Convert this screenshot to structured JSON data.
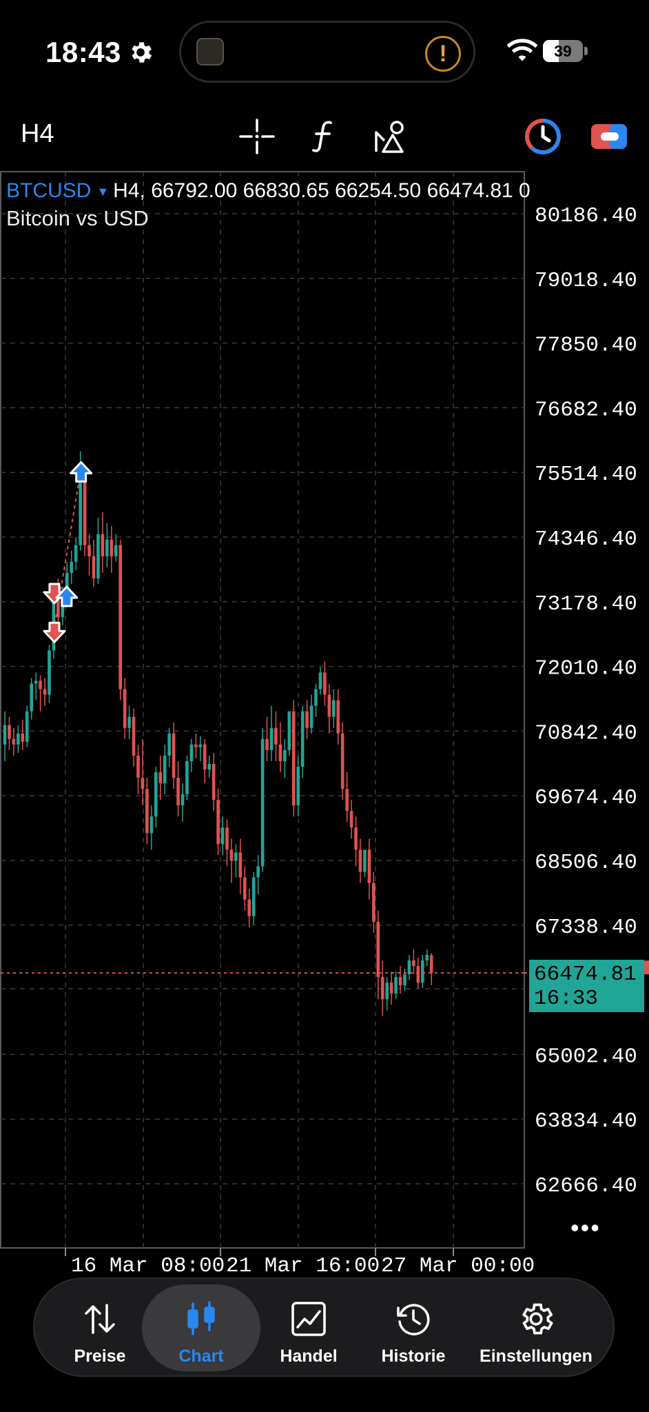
{
  "status_bar": {
    "time": "18:43",
    "battery": "39",
    "gear_icon": "gear-icon",
    "wifi_icon": "wifi-icon"
  },
  "toolbar": {
    "timeframe": "H4",
    "tools": [
      "crosshair-icon",
      "indicator-f-icon",
      "objects-icon",
      "clock-ring-icon",
      "toggle-icon"
    ]
  },
  "chart": {
    "symbol": "BTCUSD",
    "ohlc_line": "H4, 66792.00 66830.65 66254.50 66474.81 0",
    "description": "Bitcoin vs USD",
    "price_labels": [
      "80186.40",
      "79018.40",
      "77850.40",
      "76682.40",
      "75514.40",
      "74346.40",
      "73178.40",
      "72010.40",
      "70842.40",
      "69674.40",
      "68506.40",
      "67338.40",
      "65002.40",
      "63834.40",
      "62666.40"
    ],
    "time_labels": [
      "16 Mar 08:00",
      "21 Mar 16:00",
      "27 Mar 00:00"
    ],
    "current_price": "66474.81",
    "countdown": "16:33",
    "colors": {
      "bull": "#21a596",
      "bear": "#e0534f",
      "buy_arrow": "#2b86f0",
      "sell_arrow": "#e0534f",
      "accent": "#2b86f0"
    }
  },
  "chart_data": {
    "type": "candlestick",
    "title": "Bitcoin vs USD",
    "symbol": "BTCUSD",
    "timeframe": "H4",
    "ylim": [
      61750,
      80700
    ],
    "y_ticks": [
      80186.4,
      79018.4,
      77850.4,
      76682.4,
      75514.4,
      74346.4,
      73178.4,
      72010.4,
      70842.4,
      69674.4,
      68506.4,
      67338.4,
      65002.4,
      63834.4,
      62666.4
    ],
    "x_ticks": [
      "16 Mar 08:00",
      "21 Mar 16:00",
      "27 Mar 00:00"
    ],
    "last_price": 66474.81,
    "candles": [
      {
        "o": 70600,
        "h": 71200,
        "c": 70950,
        "l": 70300
      },
      {
        "o": 70950,
        "h": 71100,
        "c": 70700,
        "l": 70500
      },
      {
        "o": 70700,
        "h": 70900,
        "c": 70600,
        "l": 70400
      },
      {
        "o": 70600,
        "h": 70950,
        "c": 70800,
        "l": 70450
      },
      {
        "o": 70800,
        "h": 71050,
        "c": 70650,
        "l": 70500
      },
      {
        "o": 70650,
        "h": 71300,
        "c": 71200,
        "l": 70550
      },
      {
        "o": 71200,
        "h": 71800,
        "c": 71700,
        "l": 71050
      },
      {
        "o": 71700,
        "h": 71900,
        "c": 71750,
        "l": 71400
      },
      {
        "o": 71750,
        "h": 71850,
        "c": 71600,
        "l": 71200
      },
      {
        "o": 71600,
        "h": 71800,
        "c": 71500,
        "l": 71300
      },
      {
        "o": 71500,
        "h": 72400,
        "c": 72300,
        "l": 71350
      },
      {
        "o": 72300,
        "h": 73400,
        "c": 73300,
        "l": 72150
      },
      {
        "o": 73300,
        "h": 73600,
        "c": 72900,
        "l": 72700
      },
      {
        "o": 72900,
        "h": 73450,
        "c": 73350,
        "l": 72750
      },
      {
        "o": 73350,
        "h": 73900,
        "c": 73700,
        "l": 73150
      },
      {
        "o": 73700,
        "h": 74100,
        "c": 73900,
        "l": 73500
      },
      {
        "o": 73900,
        "h": 74350,
        "c": 74200,
        "l": 73750
      },
      {
        "o": 74200,
        "h": 75900,
        "c": 75400,
        "l": 74100
      },
      {
        "o": 75400,
        "h": 75600,
        "c": 74200,
        "l": 74000
      },
      {
        "o": 74200,
        "h": 74400,
        "c": 74000,
        "l": 73650
      },
      {
        "o": 74000,
        "h": 74300,
        "c": 73600,
        "l": 73450
      },
      {
        "o": 73600,
        "h": 74700,
        "c": 74400,
        "l": 73500
      },
      {
        "o": 74400,
        "h": 74800,
        "c": 74000,
        "l": 73700
      },
      {
        "o": 74000,
        "h": 74600,
        "c": 74300,
        "l": 73800
      },
      {
        "o": 74300,
        "h": 74550,
        "c": 74000,
        "l": 73700
      },
      {
        "o": 74000,
        "h": 74400,
        "c": 74200,
        "l": 73900
      },
      {
        "o": 74200,
        "h": 74300,
        "c": 71600,
        "l": 71400
      },
      {
        "o": 71600,
        "h": 71800,
        "c": 70900,
        "l": 70700
      },
      {
        "o": 70900,
        "h": 71300,
        "c": 71100,
        "l": 70700
      },
      {
        "o": 71100,
        "h": 71250,
        "c": 70400,
        "l": 70200
      },
      {
        "o": 70400,
        "h": 70600,
        "c": 70000,
        "l": 69700
      },
      {
        "o": 70000,
        "h": 70700,
        "c": 69800,
        "l": 69500
      },
      {
        "o": 69800,
        "h": 70000,
        "c": 69000,
        "l": 68800
      },
      {
        "o": 69000,
        "h": 69500,
        "c": 69300,
        "l": 68700
      },
      {
        "o": 69300,
        "h": 70200,
        "c": 70100,
        "l": 69100
      },
      {
        "o": 70100,
        "h": 70400,
        "c": 69900,
        "l": 69600
      },
      {
        "o": 69900,
        "h": 70600,
        "c": 70400,
        "l": 69700
      },
      {
        "o": 70400,
        "h": 70900,
        "c": 70800,
        "l": 70200
      },
      {
        "o": 70800,
        "h": 71000,
        "c": 70000,
        "l": 69800
      },
      {
        "o": 70000,
        "h": 70300,
        "c": 69500,
        "l": 69300
      },
      {
        "o": 69500,
        "h": 69900,
        "c": 69700,
        "l": 69200
      },
      {
        "o": 69700,
        "h": 70400,
        "c": 70300,
        "l": 69600
      },
      {
        "o": 70300,
        "h": 70700,
        "c": 70600,
        "l": 70100
      },
      {
        "o": 70600,
        "h": 70800,
        "c": 70550,
        "l": 70350
      },
      {
        "o": 70550,
        "h": 70750,
        "c": 70600,
        "l": 70300
      },
      {
        "o": 70600,
        "h": 70700,
        "c": 70150,
        "l": 69900
      },
      {
        "o": 70150,
        "h": 70400,
        "c": 70250,
        "l": 70000
      },
      {
        "o": 70250,
        "h": 70450,
        "c": 69600,
        "l": 69400
      },
      {
        "o": 69600,
        "h": 69800,
        "c": 68800,
        "l": 68600
      },
      {
        "o": 68800,
        "h": 69300,
        "c": 69100,
        "l": 68600
      },
      {
        "o": 69100,
        "h": 69250,
        "c": 68700,
        "l": 68400
      },
      {
        "o": 68700,
        "h": 68900,
        "c": 68500,
        "l": 68100
      },
      {
        "o": 68500,
        "h": 68800,
        "c": 68650,
        "l": 68200
      },
      {
        "o": 68650,
        "h": 68900,
        "c": 68200,
        "l": 67900
      },
      {
        "o": 68200,
        "h": 68400,
        "c": 67800,
        "l": 67600
      },
      {
        "o": 67800,
        "h": 68000,
        "c": 67500,
        "l": 67300
      },
      {
        "o": 67500,
        "h": 68300,
        "c": 68200,
        "l": 67350
      },
      {
        "o": 68200,
        "h": 68600,
        "c": 68400,
        "l": 67900
      },
      {
        "o": 68400,
        "h": 70900,
        "c": 70700,
        "l": 68300
      },
      {
        "o": 70700,
        "h": 71100,
        "c": 70500,
        "l": 70300
      },
      {
        "o": 70500,
        "h": 71300,
        "c": 70900,
        "l": 70300
      },
      {
        "o": 70900,
        "h": 71200,
        "c": 70600,
        "l": 70300
      },
      {
        "o": 70600,
        "h": 71000,
        "c": 70300,
        "l": 70100
      },
      {
        "o": 70300,
        "h": 70700,
        "c": 70500,
        "l": 70000
      },
      {
        "o": 70500,
        "h": 70700,
        "c": 71200,
        "l": 70400
      },
      {
        "o": 71200,
        "h": 71400,
        "c": 69500,
        "l": 69300
      },
      {
        "o": 69500,
        "h": 70400,
        "c": 70200,
        "l": 69300
      },
      {
        "o": 70200,
        "h": 71300,
        "c": 71200,
        "l": 70000
      },
      {
        "o": 71200,
        "h": 71400,
        "c": 70900,
        "l": 70700
      },
      {
        "o": 70900,
        "h": 71500,
        "c": 71300,
        "l": 70800
      },
      {
        "o": 71300,
        "h": 71700,
        "c": 71600,
        "l": 71100
      },
      {
        "o": 71600,
        "h": 72000,
        "c": 71900,
        "l": 71500
      },
      {
        "o": 71900,
        "h": 72100,
        "c": 71500,
        "l": 71300
      },
      {
        "o": 71500,
        "h": 71700,
        "c": 71100,
        "l": 70800
      },
      {
        "o": 71100,
        "h": 71600,
        "c": 71400,
        "l": 70900
      },
      {
        "o": 71400,
        "h": 71600,
        "c": 70800,
        "l": 70600
      },
      {
        "o": 70800,
        "h": 71000,
        "c": 69800,
        "l": 69600
      },
      {
        "o": 69800,
        "h": 70100,
        "c": 69400,
        "l": 69200
      },
      {
        "o": 69400,
        "h": 69600,
        "c": 69100,
        "l": 68900
      },
      {
        "o": 69100,
        "h": 69300,
        "c": 68700,
        "l": 68400
      },
      {
        "o": 68700,
        "h": 68900,
        "c": 68300,
        "l": 68100
      },
      {
        "o": 68300,
        "h": 68500,
        "c": 68700,
        "l": 68200
      },
      {
        "o": 68700,
        "h": 68900,
        "c": 68100,
        "l": 67800
      },
      {
        "o": 68100,
        "h": 68300,
        "c": 67400,
        "l": 67200
      },
      {
        "o": 67400,
        "h": 67600,
        "c": 66400,
        "l": 66000
      },
      {
        "o": 66400,
        "h": 66700,
        "c": 66000,
        "l": 65700
      },
      {
        "o": 66000,
        "h": 66400,
        "c": 66300,
        "l": 65800
      },
      {
        "o": 66300,
        "h": 66500,
        "c": 66100,
        "l": 65900
      },
      {
        "o": 66100,
        "h": 66500,
        "c": 66400,
        "l": 66000
      },
      {
        "o": 66400,
        "h": 66600,
        "c": 66250,
        "l": 66100
      },
      {
        "o": 66250,
        "h": 66550,
        "c": 66450,
        "l": 66150
      },
      {
        "o": 66450,
        "h": 66800,
        "c": 66700,
        "l": 66350
      },
      {
        "o": 66700,
        "h": 66900,
        "c": 66600,
        "l": 66450
      },
      {
        "o": 66600,
        "h": 66750,
        "c": 66300,
        "l": 66200
      },
      {
        "o": 66300,
        "h": 66800,
        "c": 66700,
        "l": 66200
      },
      {
        "o": 66700,
        "h": 66900,
        "c": 66800,
        "l": 66600
      },
      {
        "o": 66792,
        "h": 66830.65,
        "c": 66474.81,
        "l": 66254.5
      }
    ],
    "trade_markers": [
      {
        "type": "sell",
        "candle": 11,
        "price": 73350
      },
      {
        "type": "sell",
        "candle": 11,
        "price": 72650
      },
      {
        "type": "buy",
        "candle": 13,
        "price": 73250
      },
      {
        "type": "buy",
        "candle": 17,
        "price": 75500
      }
    ]
  },
  "nav": {
    "items": [
      {
        "label": "Preise",
        "icon": "arrows-swap-icon",
        "active": false
      },
      {
        "label": "Chart",
        "icon": "candles-icon",
        "active": true
      },
      {
        "label": "Handel",
        "icon": "trade-chart-icon",
        "active": false
      },
      {
        "label": "Historie",
        "icon": "history-icon",
        "active": false
      },
      {
        "label": "Einstellungen",
        "icon": "gear-icon",
        "active": false
      }
    ]
  }
}
